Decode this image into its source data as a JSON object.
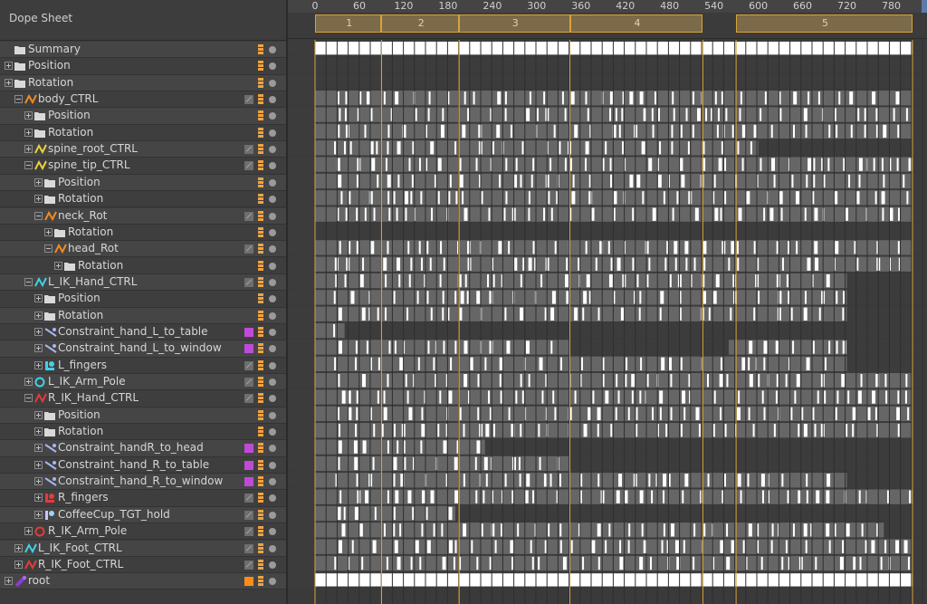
{
  "panel": {
    "title": "Dope Sheet"
  },
  "timeline": {
    "ruler_labels": [
      "0",
      "60",
      "120",
      "180",
      "240",
      "300",
      "360",
      "420",
      "480",
      "540",
      "600",
      "660",
      "720",
      "780"
    ],
    "ruler_values": [
      0,
      60,
      120,
      180,
      240,
      300,
      360,
      420,
      480,
      540,
      600,
      660,
      720,
      780
    ],
    "markers": [
      {
        "label": "1",
        "start": 0,
        "end": 90
      },
      {
        "label": "2",
        "start": 90,
        "end": 195
      },
      {
        "label": "3",
        "start": 195,
        "end": 345
      },
      {
        "label": "4",
        "start": 345,
        "end": 525
      },
      {
        "label": "5",
        "start": 570,
        "end": 810
      }
    ],
    "range_end": 810
  },
  "colors": {
    "accent": "#d9a23b",
    "key_white": "#ffffff",
    "clip_bar": "#666666",
    "track_dark": "#3c3c3c",
    "constraint_swatch": "#c04ad8",
    "root_swatch": "#ff8c1a"
  },
  "tracks": [
    {
      "label": "Summary",
      "indent": 0,
      "icon": "folder-icon",
      "control": "none",
      "expand": "none",
      "kind": "summary",
      "segments": [
        [
          0,
          810
        ]
      ]
    },
    {
      "label": "Position",
      "indent": 0,
      "icon": "folder-icon",
      "control": "none",
      "expand": "plus",
      "kind": "empty",
      "segments": []
    },
    {
      "label": "Rotation",
      "indent": 0,
      "icon": "folder-icon",
      "control": "none",
      "expand": "plus",
      "kind": "empty",
      "segments": []
    },
    {
      "label": "body_CTRL",
      "indent": 1,
      "icon": "fcurve-orange-icon",
      "control": "mode",
      "expand": "minus",
      "kind": "clip",
      "segments": [
        [
          0,
          810
        ]
      ]
    },
    {
      "label": "Position",
      "indent": 2,
      "icon": "folder-icon",
      "control": "none",
      "expand": "plus",
      "kind": "clip",
      "segments": [
        [
          0,
          810
        ]
      ]
    },
    {
      "label": "Rotation",
      "indent": 2,
      "icon": "folder-icon",
      "control": "none",
      "expand": "plus",
      "kind": "clip",
      "segments": [
        [
          0,
          810
        ]
      ]
    },
    {
      "label": "spine_root_CTRL",
      "indent": 2,
      "icon": "fcurve-yellow-icon",
      "control": "mode",
      "expand": "plus",
      "kind": "clip",
      "segments": [
        [
          0,
          600
        ]
      ]
    },
    {
      "label": "spine_tip_CTRL",
      "indent": 2,
      "icon": "fcurve-yellow-icon",
      "control": "mode",
      "expand": "minus",
      "kind": "clip",
      "segments": [
        [
          0,
          810
        ]
      ]
    },
    {
      "label": "Position",
      "indent": 3,
      "icon": "folder-icon",
      "control": "none",
      "expand": "plus",
      "kind": "clip",
      "segments": [
        [
          0,
          810
        ]
      ]
    },
    {
      "label": "Rotation",
      "indent": 3,
      "icon": "folder-icon",
      "control": "none",
      "expand": "plus",
      "kind": "clip",
      "segments": [
        [
          0,
          810
        ]
      ]
    },
    {
      "label": "neck_Rot",
      "indent": 3,
      "icon": "fcurve-orange-icon",
      "control": "mode",
      "expand": "minus",
      "kind": "clip",
      "segments": [
        [
          0,
          810
        ]
      ]
    },
    {
      "label": "Rotation",
      "indent": 4,
      "icon": "folder-icon",
      "control": "none",
      "expand": "plus",
      "kind": "clip",
      "segments": []
    },
    {
      "label": "head_Rot",
      "indent": 4,
      "icon": "fcurve-orange-icon",
      "control": "mode",
      "expand": "minus",
      "kind": "clip",
      "segments": [
        [
          0,
          810
        ]
      ]
    },
    {
      "label": "Rotation",
      "indent": 5,
      "icon": "folder-icon",
      "control": "none",
      "expand": "plus",
      "kind": "clip",
      "segments": [
        [
          0,
          810
        ]
      ]
    },
    {
      "label": "L_IK_Hand_CTRL",
      "indent": 2,
      "icon": "fcurve-cyan-icon",
      "control": "mode",
      "expand": "minus",
      "kind": "clip",
      "segments": [
        [
          0,
          720
        ]
      ]
    },
    {
      "label": "Position",
      "indent": 3,
      "icon": "folder-icon",
      "control": "none",
      "expand": "plus",
      "kind": "clip",
      "segments": [
        [
          0,
          720
        ]
      ]
    },
    {
      "label": "Rotation",
      "indent": 3,
      "icon": "folder-icon",
      "control": "none",
      "expand": "plus",
      "kind": "clip",
      "segments": [
        [
          0,
          720
        ]
      ]
    },
    {
      "label": "Constraint_hand_L_to_table",
      "indent": 3,
      "icon": "constraint-icon",
      "control": "swatch",
      "expand": "plus",
      "kind": "clip",
      "segments": [
        [
          0,
          40
        ]
      ]
    },
    {
      "label": "Constraint_hand_L_to_window",
      "indent": 3,
      "icon": "constraint-icon",
      "control": "swatch",
      "expand": "plus",
      "kind": "clip",
      "segments": [
        [
          0,
          345
        ],
        [
          560,
          720
        ]
      ]
    },
    {
      "label": "L_fingers",
      "indent": 3,
      "icon": "fingers-cyan-icon",
      "control": "mode",
      "expand": "plus",
      "kind": "clip",
      "segments": [
        [
          0,
          720
        ]
      ]
    },
    {
      "label": "L_IK_Arm_Pole",
      "indent": 2,
      "icon": "pole-cyan-icon",
      "control": "mode",
      "expand": "plus",
      "kind": "clip",
      "segments": [
        [
          0,
          810
        ]
      ]
    },
    {
      "label": "R_IK_Hand_CTRL",
      "indent": 2,
      "icon": "fcurve-red-icon",
      "control": "mode",
      "expand": "minus",
      "kind": "clip",
      "segments": [
        [
          0,
          810
        ]
      ]
    },
    {
      "label": "Position",
      "indent": 3,
      "icon": "folder-icon",
      "control": "none",
      "expand": "plus",
      "kind": "clip",
      "segments": [
        [
          0,
          810
        ]
      ]
    },
    {
      "label": "Rotation",
      "indent": 3,
      "icon": "folder-icon",
      "control": "none",
      "expand": "plus",
      "kind": "clip",
      "segments": [
        [
          0,
          810
        ]
      ]
    },
    {
      "label": "Constraint_handR_to_head",
      "indent": 3,
      "icon": "constraint-icon",
      "control": "swatch",
      "expand": "plus",
      "kind": "clip",
      "segments": [
        [
          0,
          230
        ]
      ]
    },
    {
      "label": "Constraint_hand_R_to_table",
      "indent": 3,
      "icon": "constraint-icon",
      "control": "swatch",
      "expand": "plus",
      "kind": "clip",
      "segments": [
        [
          0,
          345
        ]
      ]
    },
    {
      "label": "Constraint_hand_R_to_window",
      "indent": 3,
      "icon": "constraint-icon",
      "control": "swatch",
      "expand": "plus",
      "kind": "clip",
      "segments": [
        [
          0,
          720
        ]
      ]
    },
    {
      "label": "R_fingers",
      "indent": 3,
      "icon": "fingers-red-icon",
      "control": "mode",
      "expand": "plus",
      "kind": "clip",
      "segments": [
        [
          0,
          810
        ]
      ]
    },
    {
      "label": "CoffeeCup_TGT_hold",
      "indent": 3,
      "icon": "target-icon",
      "control": "mode",
      "expand": "plus",
      "kind": "clip",
      "segments": [
        [
          0,
          190
        ]
      ]
    },
    {
      "label": "R_IK_Arm_Pole",
      "indent": 2,
      "icon": "pole-red-icon",
      "control": "mode",
      "expand": "plus",
      "kind": "clip",
      "segments": [
        [
          0,
          770
        ]
      ]
    },
    {
      "label": "L_IK_Foot_CTRL",
      "indent": 1,
      "icon": "fcurve-cyan-icon",
      "control": "mode",
      "expand": "plus",
      "kind": "clip",
      "segments": [
        [
          0,
          810
        ]
      ]
    },
    {
      "label": "R_IK_Foot_CTRL",
      "indent": 1,
      "icon": "fcurve-red-icon",
      "control": "mode",
      "expand": "plus",
      "kind": "clip",
      "segments": [
        [
          0,
          810
        ]
      ]
    },
    {
      "label": "root",
      "indent": 0,
      "icon": "bone-purple-icon",
      "control": "swatch-orange",
      "expand": "plus",
      "kind": "summary",
      "segments": [
        [
          0,
          810
        ]
      ]
    }
  ]
}
